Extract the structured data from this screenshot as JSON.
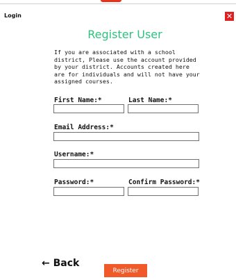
{
  "header": {
    "title": "Login",
    "close_icon": "close-icon"
  },
  "heading": "Register User",
  "intro_lines": [
    "If you are associated with a school",
    "district, Please use the account provided",
    "by your district. Accounts created here",
    "are for individuals and will not have your",
    "assigned courses."
  ],
  "form": {
    "first_name_label": "First Name:*",
    "last_name_label": "Last Name:*",
    "email_label": "Email Address:*",
    "username_label": "Username:*",
    "password_label": "Password:*",
    "confirm_password_label": "Confirm Password:*",
    "first_name_value": "",
    "last_name_value": "",
    "email_value": "",
    "username_value": "",
    "password_value": "",
    "confirm_password_value": ""
  },
  "footer": {
    "back_label": "← Back",
    "register_label": "Register"
  },
  "colors": {
    "accent_green": "#2ec27e",
    "register_orange": "#f05a2a",
    "close_red": "#e02020"
  }
}
